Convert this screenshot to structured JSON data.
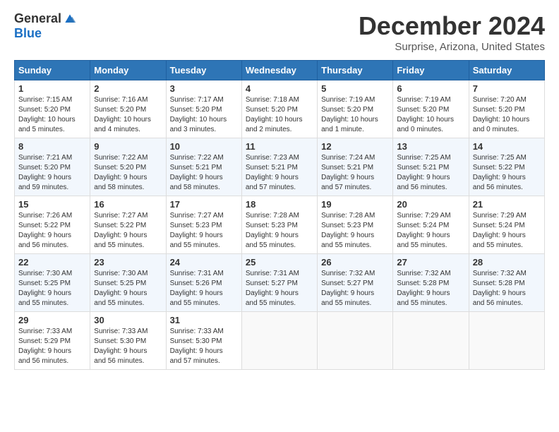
{
  "header": {
    "logo_general": "General",
    "logo_blue": "Blue",
    "month": "December 2024",
    "location": "Surprise, Arizona, United States"
  },
  "weekdays": [
    "Sunday",
    "Monday",
    "Tuesday",
    "Wednesday",
    "Thursday",
    "Friday",
    "Saturday"
  ],
  "weeks": [
    [
      {
        "day": "1",
        "info": "Sunrise: 7:15 AM\nSunset: 5:20 PM\nDaylight: 10 hours\nand 5 minutes."
      },
      {
        "day": "2",
        "info": "Sunrise: 7:16 AM\nSunset: 5:20 PM\nDaylight: 10 hours\nand 4 minutes."
      },
      {
        "day": "3",
        "info": "Sunrise: 7:17 AM\nSunset: 5:20 PM\nDaylight: 10 hours\nand 3 minutes."
      },
      {
        "day": "4",
        "info": "Sunrise: 7:18 AM\nSunset: 5:20 PM\nDaylight: 10 hours\nand 2 minutes."
      },
      {
        "day": "5",
        "info": "Sunrise: 7:19 AM\nSunset: 5:20 PM\nDaylight: 10 hours\nand 1 minute."
      },
      {
        "day": "6",
        "info": "Sunrise: 7:19 AM\nSunset: 5:20 PM\nDaylight: 10 hours\nand 0 minutes."
      },
      {
        "day": "7",
        "info": "Sunrise: 7:20 AM\nSunset: 5:20 PM\nDaylight: 10 hours\nand 0 minutes."
      }
    ],
    [
      {
        "day": "8",
        "info": "Sunrise: 7:21 AM\nSunset: 5:20 PM\nDaylight: 9 hours\nand 59 minutes."
      },
      {
        "day": "9",
        "info": "Sunrise: 7:22 AM\nSunset: 5:20 PM\nDaylight: 9 hours\nand 58 minutes."
      },
      {
        "day": "10",
        "info": "Sunrise: 7:22 AM\nSunset: 5:21 PM\nDaylight: 9 hours\nand 58 minutes."
      },
      {
        "day": "11",
        "info": "Sunrise: 7:23 AM\nSunset: 5:21 PM\nDaylight: 9 hours\nand 57 minutes."
      },
      {
        "day": "12",
        "info": "Sunrise: 7:24 AM\nSunset: 5:21 PM\nDaylight: 9 hours\nand 57 minutes."
      },
      {
        "day": "13",
        "info": "Sunrise: 7:25 AM\nSunset: 5:21 PM\nDaylight: 9 hours\nand 56 minutes."
      },
      {
        "day": "14",
        "info": "Sunrise: 7:25 AM\nSunset: 5:22 PM\nDaylight: 9 hours\nand 56 minutes."
      }
    ],
    [
      {
        "day": "15",
        "info": "Sunrise: 7:26 AM\nSunset: 5:22 PM\nDaylight: 9 hours\nand 56 minutes."
      },
      {
        "day": "16",
        "info": "Sunrise: 7:27 AM\nSunset: 5:22 PM\nDaylight: 9 hours\nand 55 minutes."
      },
      {
        "day": "17",
        "info": "Sunrise: 7:27 AM\nSunset: 5:23 PM\nDaylight: 9 hours\nand 55 minutes."
      },
      {
        "day": "18",
        "info": "Sunrise: 7:28 AM\nSunset: 5:23 PM\nDaylight: 9 hours\nand 55 minutes."
      },
      {
        "day": "19",
        "info": "Sunrise: 7:28 AM\nSunset: 5:23 PM\nDaylight: 9 hours\nand 55 minutes."
      },
      {
        "day": "20",
        "info": "Sunrise: 7:29 AM\nSunset: 5:24 PM\nDaylight: 9 hours\nand 55 minutes."
      },
      {
        "day": "21",
        "info": "Sunrise: 7:29 AM\nSunset: 5:24 PM\nDaylight: 9 hours\nand 55 minutes."
      }
    ],
    [
      {
        "day": "22",
        "info": "Sunrise: 7:30 AM\nSunset: 5:25 PM\nDaylight: 9 hours\nand 55 minutes."
      },
      {
        "day": "23",
        "info": "Sunrise: 7:30 AM\nSunset: 5:25 PM\nDaylight: 9 hours\nand 55 minutes."
      },
      {
        "day": "24",
        "info": "Sunrise: 7:31 AM\nSunset: 5:26 PM\nDaylight: 9 hours\nand 55 minutes."
      },
      {
        "day": "25",
        "info": "Sunrise: 7:31 AM\nSunset: 5:27 PM\nDaylight: 9 hours\nand 55 minutes."
      },
      {
        "day": "26",
        "info": "Sunrise: 7:32 AM\nSunset: 5:27 PM\nDaylight: 9 hours\nand 55 minutes."
      },
      {
        "day": "27",
        "info": "Sunrise: 7:32 AM\nSunset: 5:28 PM\nDaylight: 9 hours\nand 55 minutes."
      },
      {
        "day": "28",
        "info": "Sunrise: 7:32 AM\nSunset: 5:28 PM\nDaylight: 9 hours\nand 56 minutes."
      }
    ],
    [
      {
        "day": "29",
        "info": "Sunrise: 7:33 AM\nSunset: 5:29 PM\nDaylight: 9 hours\nand 56 minutes."
      },
      {
        "day": "30",
        "info": "Sunrise: 7:33 AM\nSunset: 5:30 PM\nDaylight: 9 hours\nand 56 minutes."
      },
      {
        "day": "31",
        "info": "Sunrise: 7:33 AM\nSunset: 5:30 PM\nDaylight: 9 hours\nand 57 minutes."
      },
      {
        "day": "",
        "info": ""
      },
      {
        "day": "",
        "info": ""
      },
      {
        "day": "",
        "info": ""
      },
      {
        "day": "",
        "info": ""
      }
    ]
  ]
}
